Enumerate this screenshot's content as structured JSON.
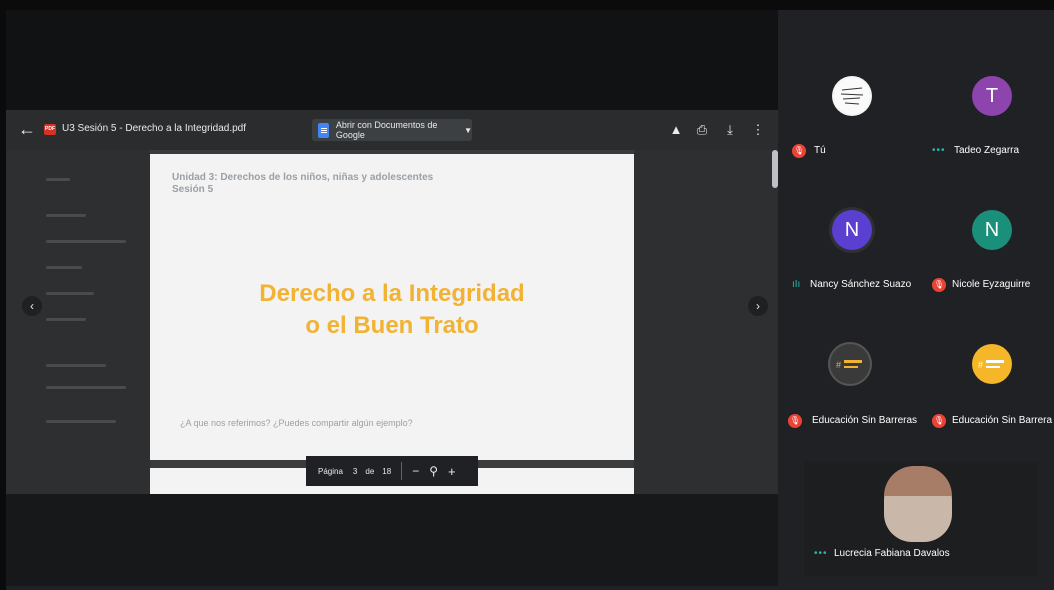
{
  "viewer": {
    "file_title": "U3 Sesión 5 - Derecho a la Integridad.pdf",
    "open_with_label": "Abrir con Documentos de Google",
    "tools": [
      "add-to-drive-icon",
      "print-icon",
      "download-icon",
      "more-icon"
    ]
  },
  "page": {
    "unit": "Unidad 3: Derechos de los niños, niñas y adolescentes",
    "session": "Sesión 5",
    "title_line1": "Derecho a la Integridad",
    "title_line2": "o el Buen Trato",
    "question": "¿A que nos referimos? ¿Puedes compartir algún ejemplo?"
  },
  "pagebar": {
    "label": "Página",
    "current": "3",
    "of": "de",
    "total": "18",
    "minus": "−",
    "zoom_icon": "⚲",
    "plus": "+"
  },
  "participants": [
    {
      "name": "Tú",
      "status": "muted",
      "avatar": "image"
    },
    {
      "name": "Tadeo Zegarra",
      "status": "speaking",
      "avatar_letter": "T",
      "color": "#8e44ad"
    },
    {
      "name": "Nancy Sánchez Suazo",
      "status": "audio",
      "avatar_letter": "N",
      "color": "#5b3fd1"
    },
    {
      "name": "Nicole Eyzaguirre",
      "status": "muted",
      "avatar_letter": "N",
      "color": "#1a8f7a"
    },
    {
      "name": "Educación Sin Barreras",
      "status": "muted",
      "avatar": "logo"
    },
    {
      "name": "Educación Sin Barrera",
      "status": "muted",
      "avatar": "logo"
    },
    {
      "name": "Lucrecia Fabiana Davalos",
      "status": "speaking",
      "avatar": "video"
    }
  ],
  "colors": {
    "accent_title": "#f2b233",
    "muted": "#ea4335",
    "speaking": "#2bb7a9"
  }
}
